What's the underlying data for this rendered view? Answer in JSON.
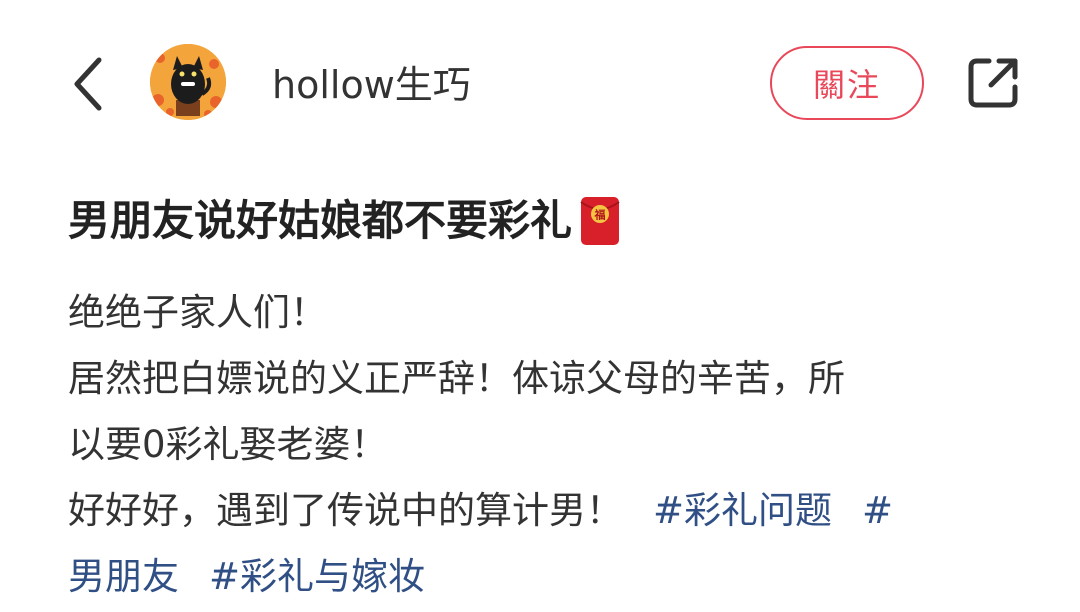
{
  "header": {
    "username": "hollow生巧",
    "follow_label": "關注"
  },
  "post": {
    "title": "男朋友说好姑娘都不要彩礼",
    "title_emoji": "red-envelope-icon",
    "title_emoji_char": "福",
    "body_lines": [
      "绝绝子家人们！",
      "居然把白嫖说的义正严辞！体谅父母的辛苦，所",
      "以要0彩礼娶老婆！",
      "好好好，遇到了传说中的算计男！"
    ],
    "hashtags": {
      "tag1": "#彩礼问题",
      "tag2_part1": "#",
      "tag2_part2": "男朋友",
      "tag3": "#彩礼与嫁妆"
    }
  },
  "colors": {
    "accent": "#e8485a",
    "hashtag": "#2f4f85",
    "text": "#333333"
  }
}
